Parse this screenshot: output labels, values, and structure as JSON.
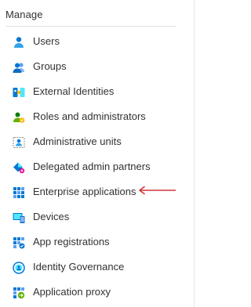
{
  "section": {
    "title": "Manage"
  },
  "nav": {
    "items": [
      {
        "label": "Users",
        "icon": "user-icon"
      },
      {
        "label": "Groups",
        "icon": "groups-icon"
      },
      {
        "label": "External Identities",
        "icon": "external-identities-icon"
      },
      {
        "label": "Roles and administrators",
        "icon": "roles-icon"
      },
      {
        "label": "Administrative units",
        "icon": "administrative-units-icon"
      },
      {
        "label": "Delegated admin partners",
        "icon": "delegated-admin-icon"
      },
      {
        "label": "Enterprise applications",
        "icon": "enterprise-apps-icon"
      },
      {
        "label": "Devices",
        "icon": "devices-icon"
      },
      {
        "label": "App registrations",
        "icon": "app-registrations-icon"
      },
      {
        "label": "Identity Governance",
        "icon": "identity-governance-icon"
      },
      {
        "label": "Application proxy",
        "icon": "application-proxy-icon"
      }
    ]
  },
  "annotation": {
    "color": "#d13438"
  }
}
